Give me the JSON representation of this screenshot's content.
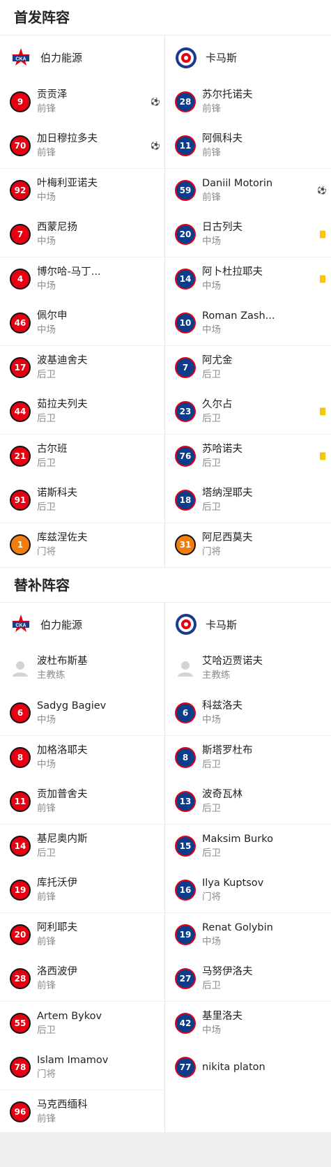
{
  "starting": {
    "title": "首发阵容",
    "home": {
      "team_name": "伯力能源",
      "players": [
        {
          "number": "9",
          "name": "贡贡泽",
          "position": "前锋",
          "event": "ball-green"
        },
        {
          "number": "70",
          "name": "加日穆拉多夫",
          "position": "前锋",
          "event": "ball"
        },
        {
          "number": "92",
          "name": "叶梅利亚诺夫",
          "position": "中场",
          "event": ""
        },
        {
          "number": "7",
          "name": "西蒙尼扬",
          "position": "中场",
          "event": ""
        },
        {
          "number": "4",
          "name": "博尔哈-马丁...",
          "position": "中场",
          "event": ""
        },
        {
          "number": "46",
          "name": "佩尔申",
          "position": "中场",
          "event": ""
        },
        {
          "number": "17",
          "name": "波基迪舍夫",
          "position": "后卫",
          "event": ""
        },
        {
          "number": "44",
          "name": "茹拉夫列夫",
          "position": "后卫",
          "event": ""
        },
        {
          "number": "21",
          "name": "古尔班",
          "position": "后卫",
          "event": ""
        },
        {
          "number": "91",
          "name": "诺斯科夫",
          "position": "后卫",
          "event": ""
        },
        {
          "number": "1",
          "name": "库兹涅佐夫",
          "position": "门将",
          "event": "",
          "gk": true
        }
      ]
    },
    "away": {
      "team_name": "卡马斯",
      "players": [
        {
          "number": "28",
          "name": "苏尔托诺夫",
          "position": "前锋",
          "event": ""
        },
        {
          "number": "11",
          "name": "阿佩科夫",
          "position": "前锋",
          "event": ""
        },
        {
          "number": "59",
          "name": "Daniil Motorin",
          "position": "前锋",
          "event": "ball"
        },
        {
          "number": "20",
          "name": "日古列夫",
          "position": "中场",
          "event": "card"
        },
        {
          "number": "14",
          "name": "阿卜杜拉耶夫",
          "position": "中场",
          "event": "card"
        },
        {
          "number": "10",
          "name": "Roman Zash...",
          "position": "中场",
          "event": ""
        },
        {
          "number": "7",
          "name": "阿尤金",
          "position": "后卫",
          "event": ""
        },
        {
          "number": "23",
          "name": "久尔占",
          "position": "后卫",
          "event": "card"
        },
        {
          "number": "76",
          "name": "苏哈诺夫",
          "position": "后卫",
          "event": "card"
        },
        {
          "number": "18",
          "name": "塔纳涅耶夫",
          "position": "后卫",
          "event": ""
        },
        {
          "number": "31",
          "name": "阿尼西莫夫",
          "position": "门将",
          "event": "",
          "gk": true
        }
      ]
    }
  },
  "subs": {
    "title": "替补阵容",
    "home": {
      "team_name": "伯力能源",
      "coach": {
        "name": "波杜布斯基",
        "role": "主教练"
      },
      "players": [
        {
          "number": "6",
          "name": "Sadyg Bagiev",
          "position": "中场"
        },
        {
          "number": "8",
          "name": "加格洛耶夫",
          "position": "中场"
        },
        {
          "number": "11",
          "name": "贡加普舍夫",
          "position": "前锋"
        },
        {
          "number": "14",
          "name": "基尼奥内斯",
          "position": "后卫"
        },
        {
          "number": "19",
          "name": "库托沃伊",
          "position": "前锋"
        },
        {
          "number": "20",
          "name": "阿利耶夫",
          "position": "前锋"
        },
        {
          "number": "28",
          "name": "洛西波伊",
          "position": "前锋"
        },
        {
          "number": "55",
          "name": "Artem Bykov",
          "position": "后卫"
        },
        {
          "number": "78",
          "name": "Islam Imamov",
          "position": "门将"
        },
        {
          "number": "96",
          "name": "马克西缅科",
          "position": "前锋"
        }
      ]
    },
    "away": {
      "team_name": "卡马斯",
      "coach": {
        "name": "艾哈迈贾诺夫",
        "role": "主教练"
      },
      "players": [
        {
          "number": "6",
          "name": "科兹洛夫",
          "position": "中场"
        },
        {
          "number": "8",
          "name": "斯塔罗杜布",
          "position": "后卫"
        },
        {
          "number": "13",
          "name": "波奇瓦林",
          "position": "后卫"
        },
        {
          "number": "15",
          "name": "Maksim Burko",
          "position": "后卫"
        },
        {
          "number": "16",
          "name": "Ilya Kuptsov",
          "position": "门将"
        },
        {
          "number": "19",
          "name": "Renat Golybin",
          "position": "中场"
        },
        {
          "number": "27",
          "name": "马努伊洛夫",
          "position": "后卫"
        },
        {
          "number": "42",
          "name": "基里洛夫",
          "position": "中场"
        },
        {
          "number": "77",
          "name": "nikita platon",
          "position": ""
        }
      ]
    }
  },
  "colors": {
    "home_jersey": "#e60012",
    "away_jersey": "#0b3d8c",
    "goalkeeper": "#f07d0d",
    "yellow_card": "#f5c800"
  },
  "icons": {
    "goal": "soccer-ball-icon",
    "own_assist": "green-soccer-ball-icon",
    "card": "yellow-card-icon",
    "coach": "person-placeholder-icon"
  }
}
